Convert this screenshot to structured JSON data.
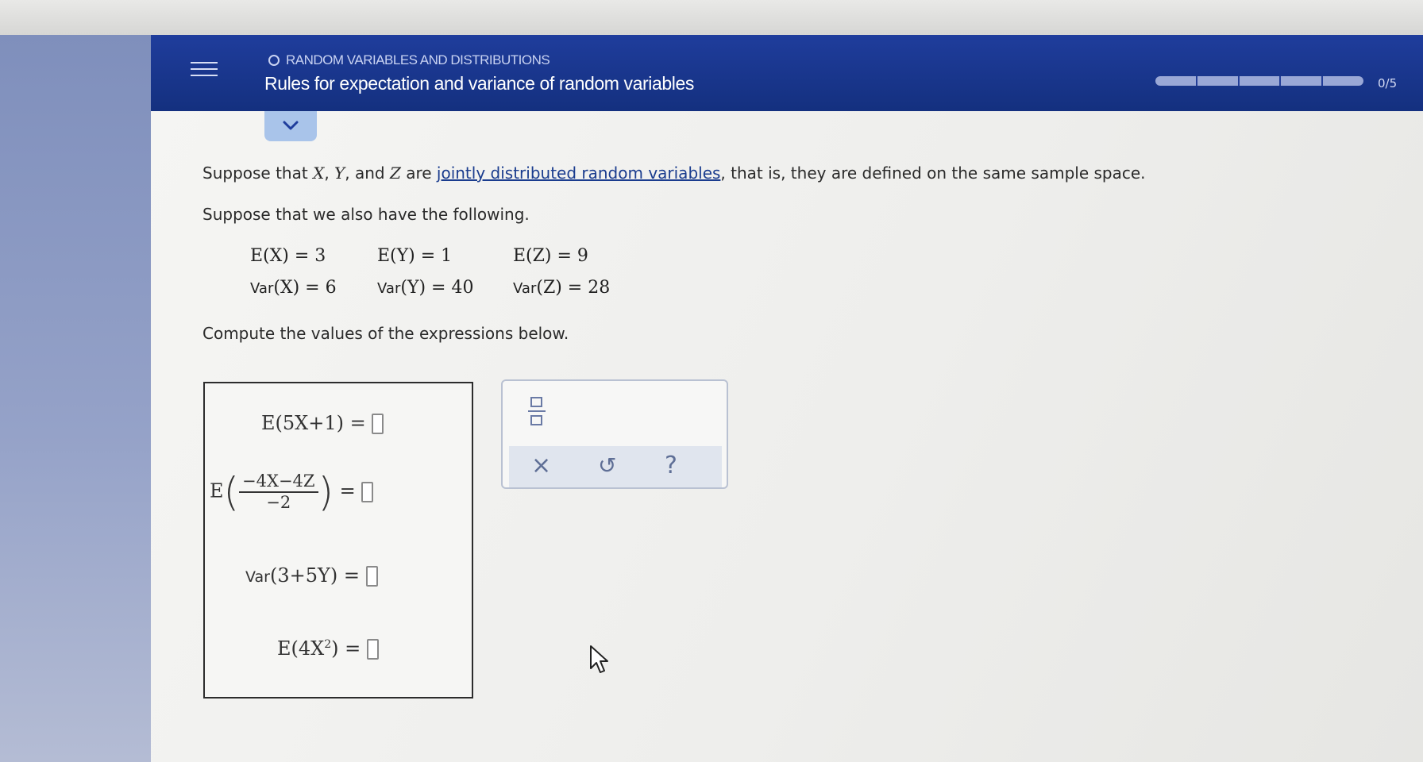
{
  "header": {
    "topic": "RANDOM VARIABLES AND DISTRIBUTIONS",
    "title": "Rules for expectation and variance of random variables",
    "progress": {
      "current": 0,
      "total": 5,
      "label": "0/5"
    }
  },
  "problem": {
    "intro_prefix": "Suppose that ",
    "var_x": "X",
    "comma": ", ",
    "var_y": "Y",
    "and_word": ", and ",
    "var_z": "Z",
    "are_word": " are ",
    "link_text": "jointly distributed random variables",
    "intro_suffix": ", that is, they are defined on the same sample space.",
    "line2": "Suppose that we also have the following.",
    "line3": "Compute the values of the expressions below."
  },
  "given": {
    "ex": "E(X) = 3",
    "ey": "E(Y) = 1",
    "ez": "E(Z) = 9",
    "vx_op": "Var",
    "vx_rest": "(X) = 6",
    "vy_op": "Var",
    "vy_rest": "(Y) = 40",
    "vz_op": "Var",
    "vz_rest": "(Z) = 28"
  },
  "expressions": {
    "e1": "E(5X+1) =",
    "e2_prefix": "E",
    "e2_num": "−4X−4Z",
    "e2_den": "−2",
    "e2_eq": "=",
    "e3_op": "Var",
    "e3_rest": "(3+5Y) =",
    "e4_prefix": "E(4X",
    "e4_sup": "2",
    "e4_suffix": ") ="
  },
  "toolbox": {
    "clear_symbol": "×",
    "undo_symbol": "↺",
    "help_symbol": "?"
  },
  "colors": {
    "header_bg": "#1a3690",
    "progress_fill": "#9aa8d6",
    "link": "#1a3c8e",
    "collapse_button": "#a9c4ea"
  },
  "icons": {
    "menu": "hamburger-icon",
    "collapse": "chevron-down-icon",
    "fraction": "fraction-icon",
    "clear": "close-icon",
    "undo": "undo-icon",
    "help": "help-icon",
    "cursor": "mouse-pointer-icon"
  }
}
